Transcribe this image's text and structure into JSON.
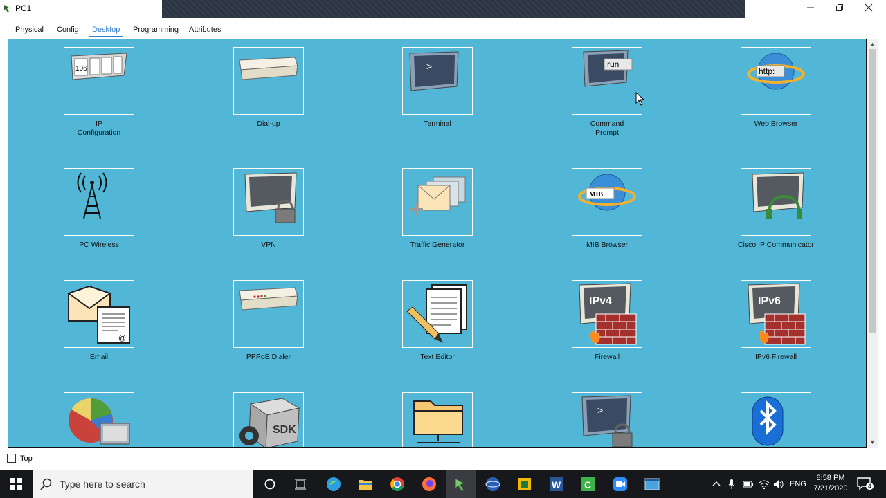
{
  "window": {
    "title": "PC1",
    "controls": [
      "minimize",
      "restore",
      "close"
    ]
  },
  "tabs": [
    {
      "label": "Physical",
      "active": false
    },
    {
      "label": "Config",
      "active": false
    },
    {
      "label": "Desktop",
      "active": true
    },
    {
      "label": "Programming",
      "active": false
    },
    {
      "label": "Attributes",
      "active": false
    }
  ],
  "apps": [
    {
      "label": "IP",
      "label2": "Configuration",
      "icon": "ip-configuration-icon"
    },
    {
      "label": "Dial-up",
      "label2": "",
      "icon": "modem-icon"
    },
    {
      "label": "Terminal",
      "label2": "",
      "icon": "terminal-icon"
    },
    {
      "label": "Command",
      "label2": "Prompt",
      "icon": "command-prompt-icon",
      "icon_text": "run"
    },
    {
      "label": "Web Browser",
      "label2": "",
      "icon": "web-browser-icon",
      "icon_text": "http:"
    },
    {
      "label": "PC Wireless",
      "label2": "",
      "icon": "wireless-tower-icon"
    },
    {
      "label": "VPN",
      "label2": "",
      "icon": "vpn-lock-icon"
    },
    {
      "label": "Traffic Generator",
      "label2": "",
      "icon": "traffic-generator-icon"
    },
    {
      "label": "MIB Browser",
      "label2": "",
      "icon": "mib-browser-icon",
      "icon_text": "MIB"
    },
    {
      "label": "Cisco IP Communicator",
      "label2": "",
      "icon": "ip-communicator-icon"
    },
    {
      "label": "Email",
      "label2": "",
      "icon": "email-icon"
    },
    {
      "label": "PPPoE Dialer",
      "label2": "",
      "icon": "pppoe-dialer-icon"
    },
    {
      "label": "Text Editor",
      "label2": "",
      "icon": "text-editor-icon"
    },
    {
      "label": "Firewall",
      "label2": "",
      "icon": "firewall-ipv4-icon",
      "icon_text": "IPv4"
    },
    {
      "label": "IPv6 Firewall",
      "label2": "",
      "icon": "firewall-ipv6-icon",
      "icon_text": "IPv6"
    },
    {
      "label": "",
      "label2": "",
      "icon": "netflow-chart-icon"
    },
    {
      "label": "",
      "label2": "",
      "icon": "sdk-gear-icon",
      "icon_text": "SDK"
    },
    {
      "label": "",
      "label2": "",
      "icon": "folder-icon"
    },
    {
      "label": "",
      "label2": "",
      "icon": "terminal-lock-icon"
    },
    {
      "label": "",
      "label2": "",
      "icon": "bluetooth-icon"
    }
  ],
  "ip_config_icon_text": "106",
  "bottom": {
    "top_checkbox_label": "Top",
    "top_checked": false
  },
  "taskbar": {
    "search_placeholder": "Type here to search",
    "time": "8:58 PM",
    "date": "7/21/2020",
    "language": "ENG",
    "notifications": "4"
  },
  "colors": {
    "desktop_bg": "#52b7d7",
    "active_tab": "#2f7fd1",
    "taskbar": "#17181c"
  }
}
